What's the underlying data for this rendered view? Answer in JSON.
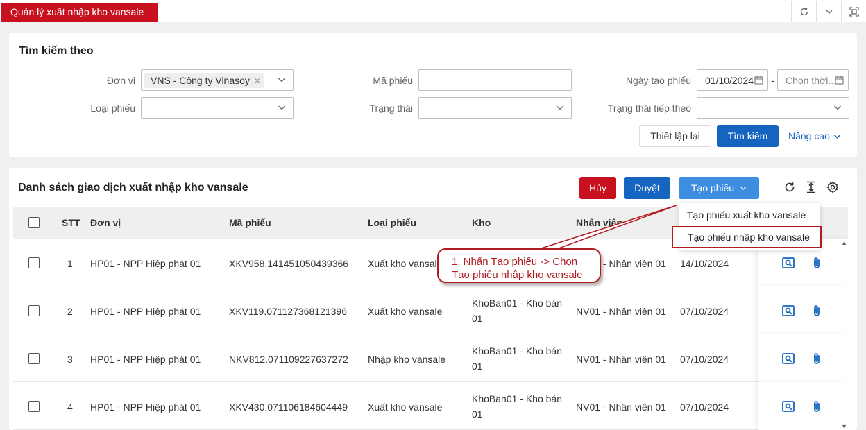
{
  "topbar": {
    "tab_label": "Quản lý xuất nhập kho vansale",
    "icons": [
      "refresh-icon",
      "chevron-down-icon",
      "fullscreen-icon"
    ]
  },
  "search": {
    "title": "Tìm kiếm theo",
    "don_vi_label": "Đơn vị",
    "don_vi_tag": "VNS - Công ty Vinasoy",
    "ma_phieu_label": "Mã phiếu",
    "ma_phieu_value": "",
    "ngay_tao_label": "Ngày tạo phiếu",
    "ngay_tu": "01/10/2024",
    "ngay_den_placeholder": "Chọn thời...",
    "dash": "-",
    "loai_phieu_label": "Loại phiếu",
    "trang_thai_label": "Trạng thái",
    "trang_thai_tiep_theo_label": "Trạng thái tiếp theo",
    "reset_label": "Thiết lập lại",
    "search_label": "Tìm kiếm",
    "advanced_label": "Nâng cao"
  },
  "list": {
    "title": "Danh sách giao dịch xuất nhập kho vansale",
    "huy_label": "Hủy",
    "duyet_label": "Duyệt",
    "tao_label": "Tạo phiếu",
    "columns": {
      "stt": "STT",
      "don_vi": "Đơn vị",
      "ma_phieu": "Mã phiếu",
      "loai_phieu": "Loại phiếu",
      "kho": "Kho",
      "nhan_vien": "Nhân viên"
    },
    "rows": [
      {
        "stt": "1",
        "don_vi": "HP01 - NPP Hiệp phát 01",
        "ma_phieu": "XKV958.141451050439366",
        "loai_phieu": "Xuất kho vansale",
        "kho_1": "",
        "kho_2": "",
        "nhan_vien": "NV01 - Nhân viên 01",
        "ngay": "14/10/2024"
      },
      {
        "stt": "2",
        "don_vi": "HP01 - NPP Hiệp phát 01",
        "ma_phieu": "XKV119.071127368121396",
        "loai_phieu": "Xuất kho vansale",
        "kho_1": "KhoBan01 - Kho bán",
        "kho_2": "01",
        "nhan_vien": "NV01 - Nhân viên 01",
        "ngay": "07/10/2024"
      },
      {
        "stt": "3",
        "don_vi": "HP01 - NPP Hiệp phát 01",
        "ma_phieu": "NKV812.071109227637272",
        "loai_phieu": "Nhập kho vansale",
        "kho_1": "KhoBan01 - Kho bán",
        "kho_2": "01",
        "nhan_vien": "NV01 - Nhân viên 01",
        "ngay": "07/10/2024"
      },
      {
        "stt": "4",
        "don_vi": "HP01 - NPP Hiệp phát 01",
        "ma_phieu": "XKV430.071106184604449",
        "loai_phieu": "Xuất kho vansale",
        "kho_1": "KhoBan01 - Kho bán",
        "kho_2": "01",
        "nhan_vien": "NV01 - Nhân viên 01",
        "ngay": "07/10/2024"
      }
    ]
  },
  "dropdown": {
    "item_xuat": "Tạo phiếu xuất kho vansale",
    "item_nhap": "Tạo phiếu nhập kho vansale"
  },
  "callout": {
    "line1": "1. Nhấn Tạo phiếu -> Chọn",
    "line2": "Tạo phiếu nhập kho vansale"
  },
  "colors": {
    "brand_red": "#c8101e",
    "primary_blue": "#1565c0",
    "callout_red": "#b01c22"
  }
}
